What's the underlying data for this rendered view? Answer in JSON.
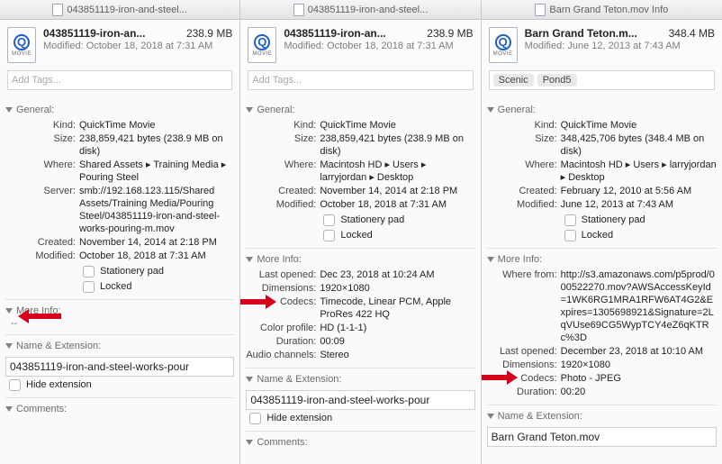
{
  "panels": [
    {
      "titlebar": "043851119-iron-and-steel...",
      "header": {
        "name": "043851119-iron-an...",
        "size": "238.9 MB",
        "modified": "Modified: October 18, 2018 at 7:31 AM"
      },
      "tags_placeholder": "Add Tags...",
      "tags": [],
      "sections": {
        "general_label": "General:",
        "general": [
          {
            "k": "Kind:",
            "v": "QuickTime Movie"
          },
          {
            "k": "Size:",
            "v": "238,859,421 bytes (238.9 MB on disk)"
          },
          {
            "k": "Where:",
            "v": "Shared Assets ▸ Training Media ▸ Pouring Steel"
          },
          {
            "k": "Server:",
            "v": "smb://192.168.123.115/Shared Assets/Training Media/Pouring Steel/043851119-iron-and-steel-works-pouring-m.mov"
          },
          {
            "k": "Created:",
            "v": "November 14, 2014 at 2:18 PM"
          },
          {
            "k": "Modified:",
            "v": "October 18, 2018 at 7:31 AM"
          }
        ],
        "stationery_label": "Stationery pad",
        "locked_label": "Locked",
        "more_info_label": "More Info:",
        "more_info": [],
        "more_info_placeholder": "--",
        "name_ext_label": "Name & Extension:",
        "name_ext_value": "043851119-iron-and-steel-works-pour",
        "hide_ext_label": "Hide extension",
        "comments_label": "Comments:"
      }
    },
    {
      "titlebar": "043851119-iron-and-steel...",
      "header": {
        "name": "043851119-iron-an...",
        "size": "238.9 MB",
        "modified": "Modified: October 18, 2018 at 7:31 AM"
      },
      "tags_placeholder": "Add Tags...",
      "tags": [],
      "sections": {
        "general_label": "General:",
        "general": [
          {
            "k": "Kind:",
            "v": "QuickTime Movie"
          },
          {
            "k": "Size:",
            "v": "238,859,421 bytes (238.9 MB on disk)"
          },
          {
            "k": "Where:",
            "v": "Macintosh HD ▸ Users ▸ larryjordan ▸ Desktop"
          },
          {
            "k": "Created:",
            "v": "November 14, 2014 at 2:18 PM"
          },
          {
            "k": "Modified:",
            "v": "October 18, 2018 at 7:31 AM"
          }
        ],
        "stationery_label": "Stationery pad",
        "locked_label": "Locked",
        "more_info_label": "More Info:",
        "more_info": [
          {
            "k": "Last opened:",
            "v": "Dec 23, 2018 at 10:24 AM"
          },
          {
            "k": "Dimensions:",
            "v": "1920×1080"
          },
          {
            "k": "Codecs:",
            "v": "Timecode, Linear PCM, Apple ProRes 422 HQ"
          },
          {
            "k": "Color profile:",
            "v": "HD (1-1-1)"
          },
          {
            "k": "Duration:",
            "v": "00:09"
          },
          {
            "k": "Audio channels:",
            "v": "Stereo"
          }
        ],
        "name_ext_label": "Name & Extension:",
        "name_ext_value": "043851119-iron-and-steel-works-pour",
        "hide_ext_label": "Hide extension",
        "comments_label": "Comments:"
      }
    },
    {
      "titlebar": "Barn Grand Teton.mov Info",
      "header": {
        "name": "Barn Grand Teton.m...",
        "size": "348.4 MB",
        "modified": "Modified: June 12, 2013 at 7:43 AM"
      },
      "tags_placeholder": "",
      "tags": [
        "Scenic",
        "Pond5"
      ],
      "sections": {
        "general_label": "General:",
        "general": [
          {
            "k": "Kind:",
            "v": "QuickTime Movie"
          },
          {
            "k": "Size:",
            "v": "348,425,706 bytes (348.4 MB on disk)"
          },
          {
            "k": "Where:",
            "v": "Macintosh HD ▸ Users ▸ larryjordan ▸ Desktop"
          },
          {
            "k": "Created:",
            "v": "February 12, 2010 at 5:56 AM"
          },
          {
            "k": "Modified:",
            "v": "June 12, 2013 at 7:43 AM"
          }
        ],
        "stationery_label": "Stationery pad",
        "locked_label": "Locked",
        "more_info_label": "More Info:",
        "more_info": [
          {
            "k": "Where from:",
            "v": "http://s3.amazonaws.com/p5prod/000522270.mov?AWSAccessKeyId=1WK6RG1MRA1RFW6AT4G2&Expires=1305698921&Signature=2LqVUse69CG5WypTCY4eZ6qKTRc%3D"
          },
          {
            "k": "Last opened:",
            "v": "December 23, 2018 at 10:10 AM"
          },
          {
            "k": "Dimensions:",
            "v": "1920×1080"
          },
          {
            "k": "Codecs:",
            "v": "Photo - JPEG"
          },
          {
            "k": "Duration:",
            "v": "00:20"
          }
        ],
        "name_ext_label": "Name & Extension:",
        "name_ext_value": "Barn Grand Teton.mov"
      }
    }
  ]
}
